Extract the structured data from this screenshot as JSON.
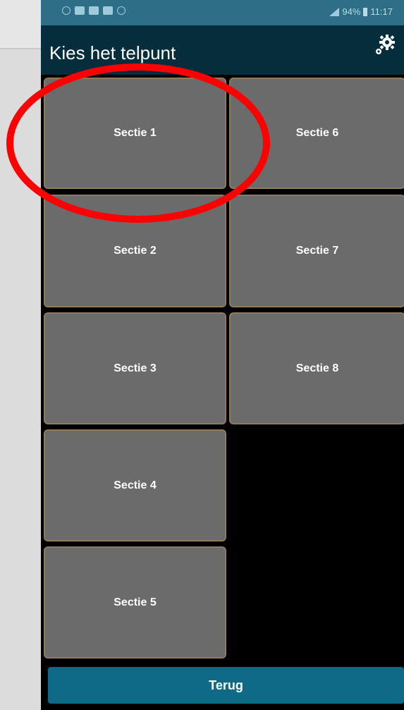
{
  "status_bar": {
    "battery": "94%",
    "time": "11:17"
  },
  "app_bar": {
    "title": "Kies het telpunt",
    "settings_icon": "gear-icon"
  },
  "sections": [
    {
      "label": "Sectie 1"
    },
    {
      "label": "Sectie 2"
    },
    {
      "label": "Sectie 3"
    },
    {
      "label": "Sectie 4"
    },
    {
      "label": "Sectie 5"
    },
    {
      "label": "Sectie 6"
    },
    {
      "label": "Sectie 7"
    },
    {
      "label": "Sectie 8"
    }
  ],
  "footer": {
    "back_label": "Terug"
  },
  "colors": {
    "status_bar": "#2f6e87",
    "app_bar": "#062d3b",
    "tile": "#6b6b6b",
    "tile_border": "#8f7b5a",
    "button": "#0e6a86",
    "annotation": "#ff0000"
  }
}
